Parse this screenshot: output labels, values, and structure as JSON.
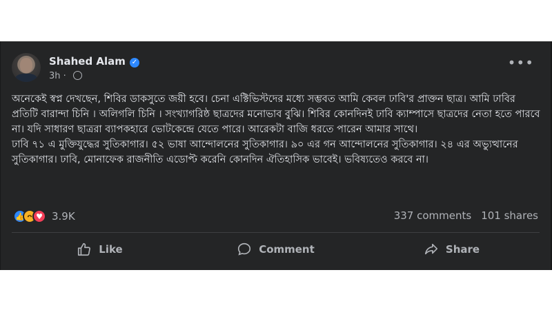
{
  "post": {
    "author": "Shahed Alam",
    "time": "3h",
    "paragraphs": [
      "অনেকেই স্বপ্ন দেখছেন, শিবির ডাকসুতে জয়ী হবে। চেনা এক্টিভিস্টদের মধ্যে সম্ভবত আমি কেবল ঢাবি'র প্রাক্তন ছাত্র। আমি ঢাবির প্রতিটি বারান্দা চিনি । অলিগলি চিনি । সংখ্যাগরিষ্ঠ ছাত্রদের মনোভাব বুঝি। শিবির কোনদিনই ঢাবি ক্যাম্পাসে ছাত্রদের নেতা হতে পারবে না। যদি সাধারণ ছাত্ররা ব্যাপকহারে ভোটকেন্দ্রে যেতে পারে। আরেকটা বাজি ধরতে পারেন আমার সাথে।",
      "ঢাবি ৭১ এ মুক্তিযুদ্ধের সুতিকাগার। ৫২ ভাষা আন্দোলনের সুতিকাগার। ৯০ এর গন আন্দোলনের সুতিকাগার। ২৪ এর অভ্যুত্থানের সুতিকাগার। ঢাবি, মোনাফেক রাজনীতি এডোপ্ট করেনি কোনদিন ঐতিহাসিক ভাবেই। ভবিষ্যতেও করবে না।"
    ],
    "reaction_icons": [
      "like-icon",
      "haha-icon",
      "love-icon"
    ],
    "reaction_count": "3.9K",
    "comments": "337 comments",
    "shares": "101 shares"
  },
  "actions": {
    "like": "Like",
    "comment": "Comment",
    "share": "Share"
  },
  "colors": {
    "card": "#242526",
    "text": "#e4e6eb",
    "muted": "#b0b3b8",
    "accent": "#2d88ff"
  }
}
